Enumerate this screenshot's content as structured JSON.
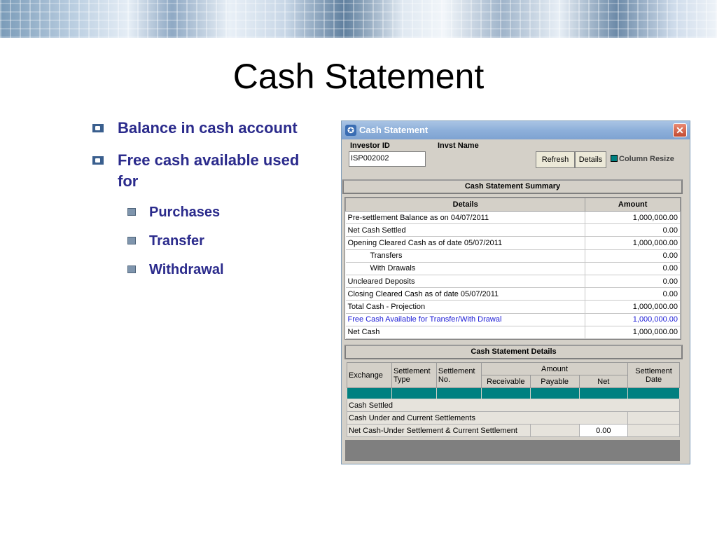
{
  "slide": {
    "title": "Cash Statement",
    "bullets": [
      {
        "text": "Balance in cash account"
      },
      {
        "text": "Free cash available used for"
      }
    ],
    "subbullets": [
      {
        "text": "Purchases"
      },
      {
        "text": "Transfer"
      },
      {
        "text": "Withdrawal"
      }
    ]
  },
  "window": {
    "title": "Cash Statement",
    "investor_id_label": "Investor ID",
    "invst_name_label": "Invst Name",
    "investor_id_value": "ISP002002",
    "refresh_label": "Refresh",
    "details_label": "Details",
    "column_resize_label": "Column Resize",
    "summary_section": "Cash Statement Summary",
    "summary_headers": {
      "details": "Details",
      "amount": "Amount"
    },
    "summary_rows": [
      {
        "label": "Pre-settlement Balance as on 04/07/2011",
        "amount": "1,000,000.00"
      },
      {
        "label": "Net Cash Settled",
        "amount": "0.00"
      },
      {
        "label": "Opening Cleared Cash as of date 05/07/2011",
        "amount": "1,000,000.00"
      },
      {
        "label": "Transfers",
        "amount": "0.00"
      },
      {
        "label": "With Drawals",
        "amount": "0.00"
      },
      {
        "label": "Uncleared Deposits",
        "amount": "0.00"
      },
      {
        "label": "Closing Cleared Cash as of date 05/07/2011",
        "amount": "0.00"
      },
      {
        "label": "Total Cash - Projection",
        "amount": "1,000,000.00"
      },
      {
        "label": "Free Cash Available for Transfer/With Drawal",
        "amount": "1,000,000.00"
      },
      {
        "label": "Net Cash",
        "amount": "1,000,000.00"
      }
    ],
    "details_section": "Cash Statement Details",
    "details_headers": {
      "exchange": "Exchange",
      "settlement_type": "Settlement Type",
      "settlement_no": "Settlement No.",
      "amount": "Amount",
      "receivable": "Receivable",
      "payable": "Payable",
      "net": "Net",
      "settlement_date": "Settlement Date"
    },
    "details_rows": {
      "cash_settled": "Cash Settled",
      "under_current": "Cash Under and Current Settlements",
      "net_cash_under": "Net Cash-Under Settlement & Current Settlement",
      "net_cash_under_value": "0.00"
    }
  }
}
